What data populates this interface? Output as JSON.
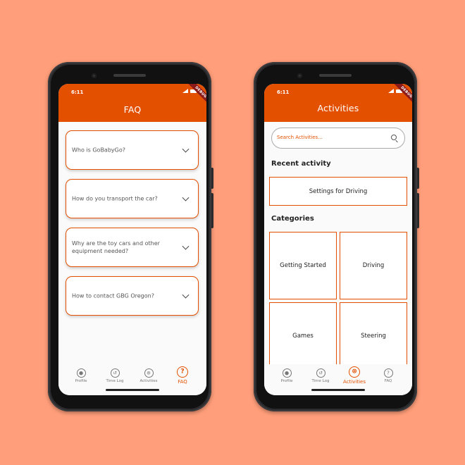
{
  "background_color": "#FF9E7A",
  "accent_color": "#E35000",
  "faq_screen": {
    "status_time": "6:11",
    "debug_banner": "DEBUG",
    "title": "FAQ",
    "questions": [
      "Who is GoBabyGo?",
      "How do you transport the car?",
      "Why are the toy cars and other equipment needed?",
      "How to contact GBG Oregon?"
    ],
    "nav": [
      {
        "label": "Profile",
        "icon": "profile-icon",
        "active": false
      },
      {
        "label": "Time Log",
        "icon": "history-icon",
        "active": false
      },
      {
        "label": "Activities",
        "icon": "steering-wheel-icon",
        "active": false
      },
      {
        "label": "FAQ",
        "icon": "help-icon",
        "active": true
      }
    ]
  },
  "activities_screen": {
    "status_time": "6:11",
    "debug_banner": "DEBUG",
    "title": "Activities",
    "search_placeholder": "Search Activities...",
    "recent_heading": "Recent activity",
    "recent_item": "Settings for Driving",
    "categories_heading": "Categories",
    "categories": [
      "Getting Started",
      "Driving",
      "Games",
      "Steering"
    ],
    "nav": [
      {
        "label": "Profile",
        "icon": "profile-icon",
        "active": false
      },
      {
        "label": "Time Log",
        "icon": "history-icon",
        "active": false
      },
      {
        "label": "Activities",
        "icon": "steering-wheel-icon",
        "active": true
      },
      {
        "label": "FAQ",
        "icon": "help-icon",
        "active": false
      }
    ]
  }
}
